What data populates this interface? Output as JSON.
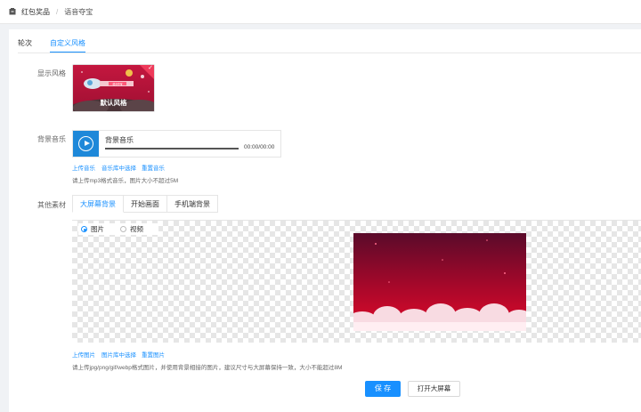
{
  "breadcrumb": {
    "items": [
      "红包奖品",
      "语音夺宝"
    ],
    "separator": "/"
  },
  "tabs": [
    {
      "label": "轮次",
      "active": false
    },
    {
      "label": "自定义风格",
      "active": true
    }
  ],
  "display_style": {
    "label": "显示风格",
    "card_caption": "默认风格",
    "card_banner": "语音夺宝"
  },
  "bgm": {
    "label": "背景音乐",
    "title": "背景音乐",
    "time": "00:00/00:00",
    "links": [
      "上传音乐",
      "音乐库中选择",
      "重置音乐"
    ],
    "hint": "请上传mp3格式音乐，图片大小不超过5M"
  },
  "other_material": {
    "label": "其他素材",
    "subtabs": [
      {
        "label": "大屏幕背景",
        "active": true
      },
      {
        "label": "开始画面",
        "active": false
      },
      {
        "label": "手机端背景",
        "active": false
      }
    ],
    "media_type": {
      "options": [
        "图片",
        "视频"
      ],
      "selected": "图片"
    },
    "links": [
      "上传图片",
      "图片库中选择",
      "重置图片"
    ],
    "hint": "请上传jpg/png/gif/webp格式图片，并使用背景相接的图片，建议尺寸与大屏幕保持一致，大小不能超过8M"
  },
  "actions": {
    "save": "保 存",
    "open": "打开大屏幕"
  },
  "colors": {
    "accent": "#1890ff",
    "play_button": "#1e88d9",
    "preview_top": "#5a0a2a",
    "preview_bottom": "#e00a2a"
  }
}
